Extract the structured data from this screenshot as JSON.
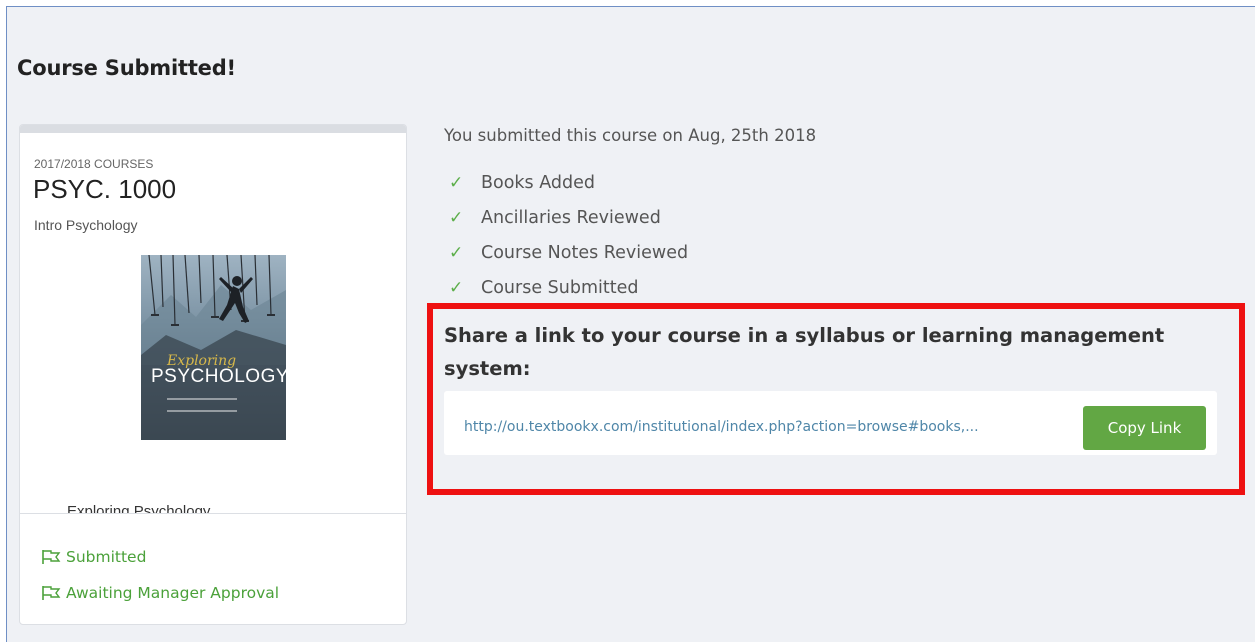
{
  "page": {
    "title": "Course Submitted!"
  },
  "course_card": {
    "term": "2017/2018 COURSES",
    "code": "PSYC. 1000",
    "name": "Intro Psychology",
    "book_cover": {
      "script_text": "Exploring",
      "title_text": "PSYCHOLOGY"
    },
    "book_title": "Exploring Psychology",
    "statuses": [
      {
        "label": "Submitted",
        "icon": "flag-icon"
      },
      {
        "label": "Awaiting Manager Approval",
        "icon": "flag-icon"
      }
    ]
  },
  "summary": {
    "submitted_on": "You submitted this course on Aug, 25th 2018",
    "checks": [
      "Books Added",
      "Ancillaries Reviewed",
      "Course Notes Reviewed",
      "Course Submitted"
    ],
    "check_glyph": "✓"
  },
  "share": {
    "heading": "Share a link to your course in a syllabus or learning management system:",
    "link": "http://ou.textbookx.com/institutional/index.php?action=browse#books,...",
    "copy_label": "Copy Link"
  },
  "colors": {
    "accent_green": "#62a744",
    "check_green": "#5cae4a",
    "status_green": "#4ba13a",
    "highlight_red": "#ee1111",
    "link_blue": "#4f86a8"
  }
}
